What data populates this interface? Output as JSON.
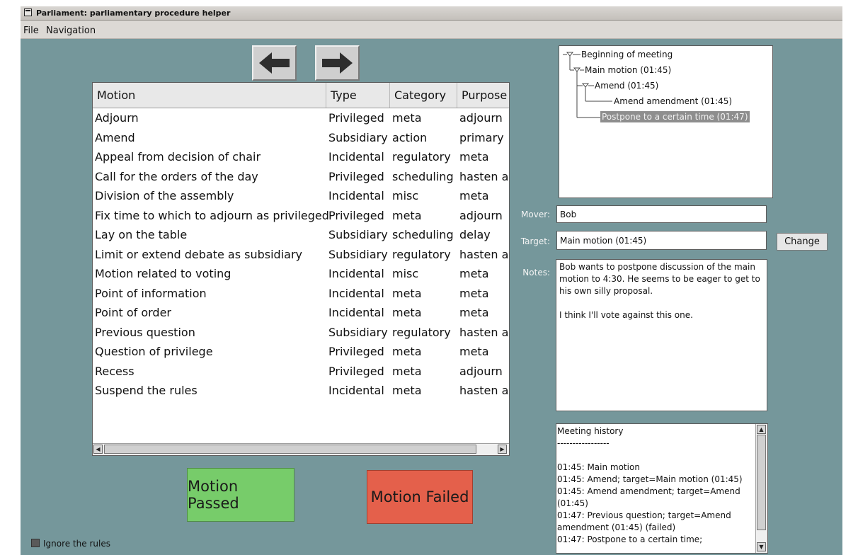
{
  "window": {
    "title": "Parliament: parliamentary procedure helper"
  },
  "menu": [
    "File",
    "Navigation"
  ],
  "nav": {
    "back_icon": "left-arrow-icon",
    "forward_icon": "right-arrow-icon"
  },
  "motions": {
    "columns": [
      "Motion",
      "Type",
      "Category",
      "Purpose"
    ],
    "rows": [
      [
        "Adjourn",
        "Privileged",
        "meta",
        "adjourn"
      ],
      [
        "Amend",
        "Subsidiary",
        "action",
        "primary"
      ],
      [
        "Appeal from decision of chair",
        "Incidental",
        "regulatory",
        "meta"
      ],
      [
        "Call for the orders of the day",
        "Privileged",
        "scheduling",
        "hasten ac"
      ],
      [
        "Division of the assembly",
        "Incidental",
        "misc",
        "meta"
      ],
      [
        "Fix time to which to adjourn as privileged",
        "Privileged",
        "meta",
        "adjourn"
      ],
      [
        "Lay on the table",
        "Subsidiary",
        "scheduling",
        "delay"
      ],
      [
        "Limit or extend debate as subsidiary",
        "Subsidiary",
        "regulatory",
        "hasten ac"
      ],
      [
        "Motion related to voting",
        "Incidental",
        "misc",
        "meta"
      ],
      [
        "Point of information",
        "Incidental",
        "meta",
        "meta"
      ],
      [
        "Point of order",
        "Incidental",
        "meta",
        "meta"
      ],
      [
        "Previous question",
        "Subsidiary",
        "regulatory",
        "hasten ac"
      ],
      [
        "Question of privilege",
        "Privileged",
        "meta",
        "meta"
      ],
      [
        "Recess",
        "Privileged",
        "meta",
        "adjourn"
      ],
      [
        "Suspend the rules",
        "Incidental",
        "meta",
        "hasten ac"
      ]
    ]
  },
  "buttons": {
    "passed": "Motion Passed",
    "failed": "Motion Failed",
    "change": "Change"
  },
  "colors": {
    "background": "#75979b",
    "passed": "#77cc6a",
    "failed": "#e4604b"
  },
  "tree": {
    "nodes": [
      "Beginning of meeting",
      "Main motion (01:45)",
      "Amend (01:45)",
      "Amend amendment (01:45)",
      "Postpone to a certain time (01:47)"
    ],
    "selected": "Postpone to a certain time (01:47)"
  },
  "form": {
    "mover_label": "Mover:",
    "mover": "Bob",
    "target_label": "Target:",
    "target": "Main motion (01:45)",
    "notes_label": "Notes:",
    "notes": [
      "Bob wants to postpone discussion of the main motion to 4:30. He seems to be eager to get to his own silly proposal.",
      "I think I'll vote against this one."
    ]
  },
  "history": {
    "lines": [
      "Meeting history",
      "-----------------",
      "",
      "01:45: Main motion",
      "01:45: Amend; target=Main motion (01:45)",
      "01:45: Amend amendment; target=Amend (01:45)",
      "01:47: Previous question; target=Amend amendment (01:45) (failed)",
      "01:47: Postpone to a certain time;"
    ]
  },
  "options": {
    "ignore_rules": "Ignore the rules",
    "ignore_rules_checked": false
  }
}
